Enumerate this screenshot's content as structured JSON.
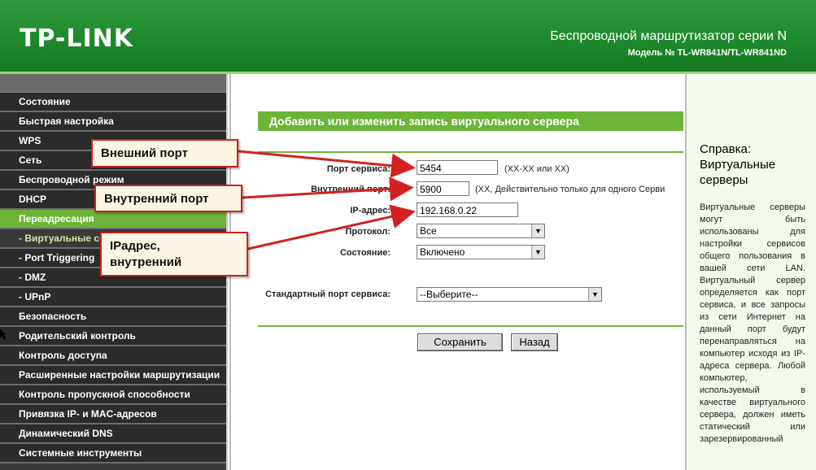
{
  "header": {
    "logo": "TP-LINK",
    "title": "Беспроводной маршрутизатор серии N",
    "model": "Модель № TL-WR841N/TL-WR841ND"
  },
  "menu": [
    {
      "label": "Состояние",
      "active": false,
      "sub": false
    },
    {
      "label": "Быстрая настройка",
      "active": false,
      "sub": false
    },
    {
      "label": "WPS",
      "active": false,
      "sub": false
    },
    {
      "label": "Сеть",
      "active": false,
      "sub": false
    },
    {
      "label": "Беспроводной режим",
      "active": false,
      "sub": false
    },
    {
      "label": "DHCP",
      "active": false,
      "sub": false
    },
    {
      "label": "Переадресация",
      "active": true,
      "sub": false
    },
    {
      "label": "- Виртуальные серверы",
      "active": true,
      "sub": true
    },
    {
      "label": "- Port Triggering",
      "active": false,
      "sub": true
    },
    {
      "label": "- DMZ",
      "active": false,
      "sub": true
    },
    {
      "label": "- UPnP",
      "active": false,
      "sub": true
    },
    {
      "label": "Безопасность",
      "active": false,
      "sub": false
    },
    {
      "label": "Родительский контроль",
      "active": false,
      "sub": false
    },
    {
      "label": "Контроль доступа",
      "active": false,
      "sub": false
    },
    {
      "label": "Расширенные настройки маршрутизации",
      "active": false,
      "sub": false
    },
    {
      "label": "Контроль пропускной способности",
      "active": false,
      "sub": false
    },
    {
      "label": "Привязка IP- и MAC-адресов",
      "active": false,
      "sub": false
    },
    {
      "label": "Динамический DNS",
      "active": false,
      "sub": false
    },
    {
      "label": "Системные инструменты",
      "active": false,
      "sub": false
    }
  ],
  "form": {
    "title": "Добавить или изменить запись виртуального сервера",
    "service_port_label": "Порт сервиса:",
    "service_port_value": "5454",
    "service_port_hint": "(XX-XX или XX)",
    "internal_port_label": "Внутренний порт:",
    "internal_port_value": "5900",
    "internal_port_hint": "(XX, Действительно только для одного Серви",
    "ip_label": "IP-адрес:",
    "ip_value": "192.168.0.22",
    "protocol_label": "Протокол:",
    "protocol_value": "Все",
    "status_label": "Состояние:",
    "status_value": "Включено",
    "std_port_label": "Стандартный порт сервиса:",
    "std_port_value": "--Выберите--",
    "save_label": "Сохранить",
    "back_label": "Назад"
  },
  "help": {
    "title": "Справка: Виртуальные серверы",
    "text": "Виртуальные серверы могут быть использованы для настройки сервисов общего пользования в вашей сети LAN. Виртуальный сервер определяется как порт сервиса, и все запросы из сети Интернет на данный порт будут перенаправляться на компьютер исходя из IP-адреса сервера. Любой компьютер, используемый в качестве виртуального сервера, должен иметь статический или зарезервированный"
  },
  "callouts": {
    "external_port": "Внешний порт",
    "internal_port": "Внутренний порт",
    "ip_internal_line1": "IPадрес,",
    "ip_internal_line2": "внутренний"
  },
  "colors": {
    "brand_green": "#1f8a2c",
    "accent_green": "#6bb437",
    "callout_border": "#d42020"
  }
}
